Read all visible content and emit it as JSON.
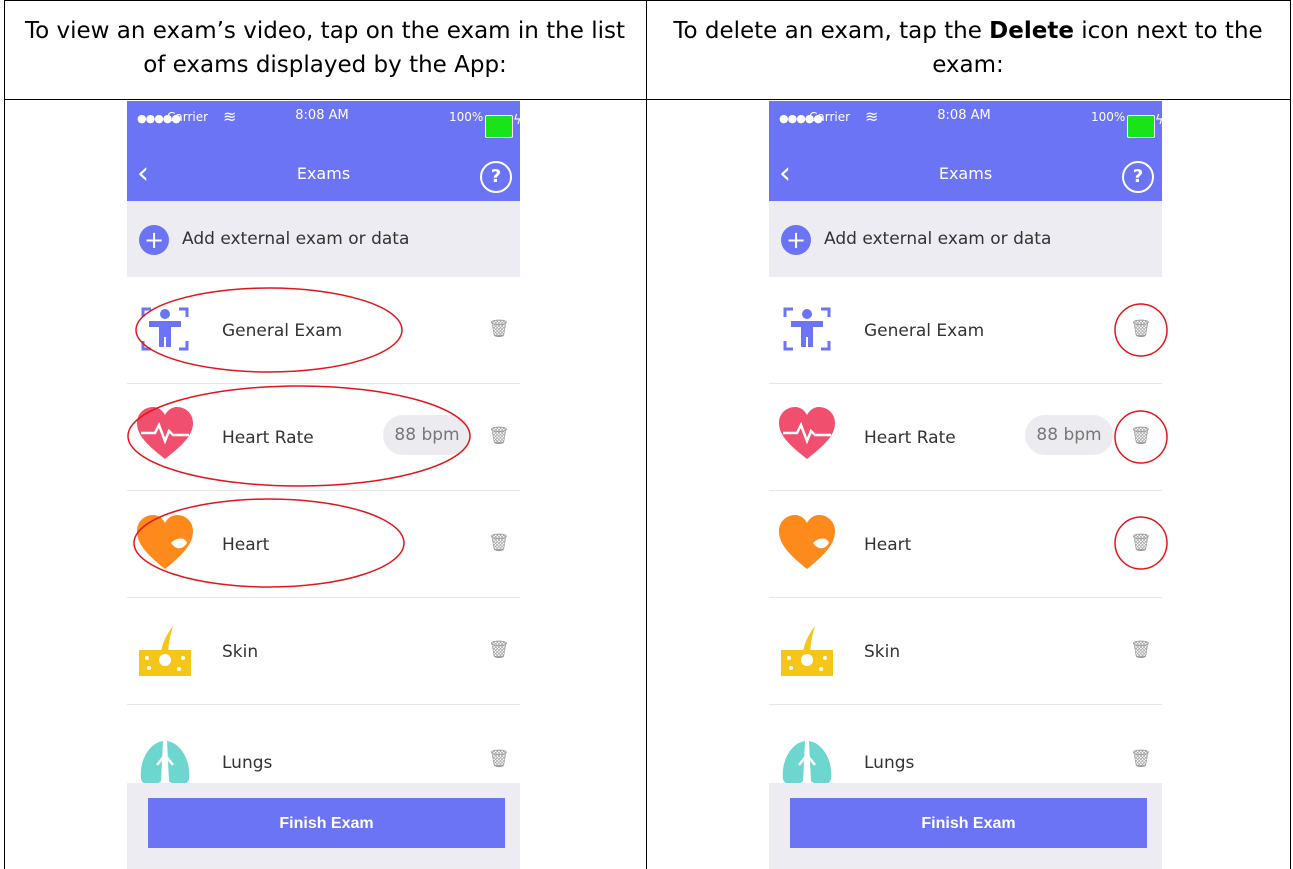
{
  "columns": [
    {
      "caption_text": "To view an exam’s video, tap on the exam in the list of exams displayed by the App:"
    },
    {
      "caption_before": "To delete an exam, tap the ",
      "caption_bold": "Delete",
      "caption_after": " icon next to the exam:"
    }
  ],
  "phone": {
    "status": {
      "carrier": "Carrier",
      "time": "8:08 AM",
      "battery": "100%"
    },
    "nav": {
      "title": "Exams"
    },
    "add_label": "Add external exam or data",
    "exams": [
      {
        "label": "General Exam",
        "icon": "general-exam-icon"
      },
      {
        "label": "Heart Rate",
        "icon": "heart-rate-icon",
        "value": "88 bpm"
      },
      {
        "label": "Heart",
        "icon": "heart-icon"
      },
      {
        "label": "Skin",
        "icon": "skin-icon"
      },
      {
        "label": "Lungs",
        "icon": "lungs-icon"
      }
    ],
    "finish_label": "Finish Exam"
  },
  "colors": {
    "accent": "#6b74f4",
    "annotation": "#e0161b",
    "heart_rate": "#f0506e",
    "heart": "#ff8a1c",
    "skin": "#f5c518",
    "lungs": "#6cd6cf"
  }
}
